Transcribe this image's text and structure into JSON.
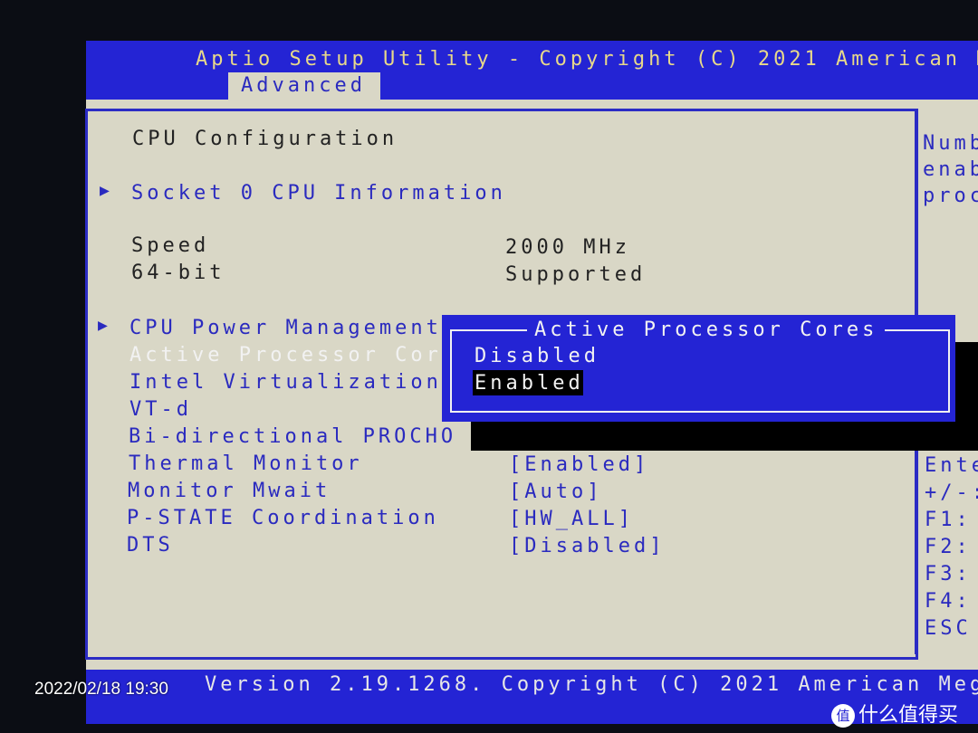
{
  "header": {
    "title": "Aptio Setup Utility - Copyright (C) 2021 American M",
    "active_tab": "Advanced"
  },
  "main": {
    "section_title": "CPU Configuration",
    "submenus": [
      {
        "label": "Socket 0 CPU Information"
      },
      {
        "label": "CPU Power Management"
      }
    ],
    "info": [
      {
        "label": "Speed",
        "value": "2000 MHz"
      },
      {
        "label": "64-bit",
        "value": "Supported"
      }
    ],
    "settings": [
      {
        "label": "Active Processor Cor",
        "value": ""
      },
      {
        "label": "Intel Virtualization",
        "value": ""
      },
      {
        "label": "VT-d",
        "value": ""
      },
      {
        "label": "Bi-directional PROCHO",
        "value": ""
      },
      {
        "label": "Thermal Monitor",
        "value": "[Enabled]"
      },
      {
        "label": "Monitor Mwait",
        "value": "[Auto]"
      },
      {
        "label": "P-STATE Coordination",
        "value": "[HW_ALL]"
      },
      {
        "label": "DTS",
        "value": "[Disabled]"
      }
    ]
  },
  "help": {
    "lines": [
      "Numb",
      "enab",
      "proc"
    ]
  },
  "keys": [
    "Ente",
    "+/-:",
    "F1:",
    "F2:",
    "F3:",
    "F4:",
    "ESC"
  ],
  "popup": {
    "title": "Active Processor Cores",
    "options": [
      "Disabled",
      "Enabled"
    ],
    "selected": "Enabled"
  },
  "footer": {
    "version": "Version 2.19.1268. Copyright (C) 2021 American Meg"
  },
  "overlay": {
    "timestamp": "2022/02/18 19:30",
    "watermark": "什么值得买"
  },
  "colors": {
    "blue_bar": "#2424d4",
    "panel": "#d9d7c6",
    "text_blue": "#2a2abf",
    "header_text": "#e8d98a"
  }
}
